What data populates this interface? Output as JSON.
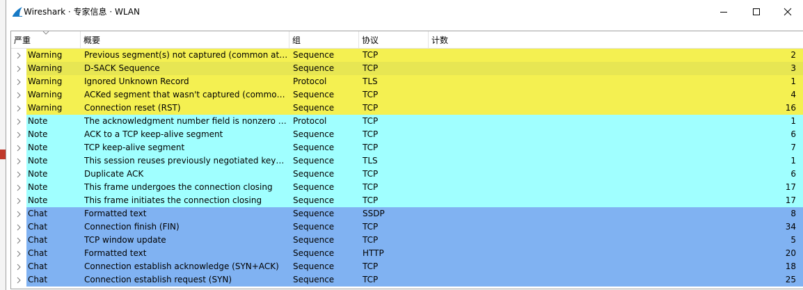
{
  "window": {
    "title": "Wireshark · 专家信息 · WLAN",
    "controls": {
      "minimize": "minimize",
      "maximize": "maximize",
      "close": "close"
    }
  },
  "colors": {
    "warning": "#f4f051",
    "warning_selected": "#e7e653",
    "note": "#a0ffff",
    "chat": "#80b2f2"
  },
  "table": {
    "columns": [
      "严重",
      "概要",
      "组",
      "协议",
      "计数"
    ],
    "rows": [
      {
        "severity": "Warning",
        "summary": "Previous segment(s) not captured (common at capture start)",
        "group": "Sequence",
        "protocol": "TCP",
        "count": "2",
        "type": "warning"
      },
      {
        "severity": "Warning",
        "summary": "D-SACK Sequence",
        "group": "Sequence",
        "protocol": "TCP",
        "count": "3",
        "type": "warning_selected"
      },
      {
        "severity": "Warning",
        "summary": "Ignored Unknown Record",
        "group": "Protocol",
        "protocol": "TLS",
        "count": "1",
        "type": "warning"
      },
      {
        "severity": "Warning",
        "summary": "ACKed segment that wasn't captured (common at capture start)",
        "group": "Sequence",
        "protocol": "TCP",
        "count": "4",
        "type": "warning"
      },
      {
        "severity": "Warning",
        "summary": "Connection reset (RST)",
        "group": "Sequence",
        "protocol": "TCP",
        "count": "16",
        "type": "warning"
      },
      {
        "severity": "Note",
        "summary": "The acknowledgment number field is nonzero while the ACK flag is not set",
        "group": "Protocol",
        "protocol": "TCP",
        "count": "1",
        "type": "note"
      },
      {
        "severity": "Note",
        "summary": "ACK to a TCP keep-alive segment",
        "group": "Sequence",
        "protocol": "TCP",
        "count": "6",
        "type": "note"
      },
      {
        "severity": "Note",
        "summary": "TCP keep-alive segment",
        "group": "Sequence",
        "protocol": "TCP",
        "count": "7",
        "type": "note"
      },
      {
        "severity": "Note",
        "summary": "This session reuses previously negotiated keys (Session resumption)",
        "group": "Sequence",
        "protocol": "TLS",
        "count": "1",
        "type": "note"
      },
      {
        "severity": "Note",
        "summary": "Duplicate ACK",
        "group": "Sequence",
        "protocol": "TCP",
        "count": "6",
        "type": "note"
      },
      {
        "severity": "Note",
        "summary": "This frame undergoes the connection closing",
        "group": "Sequence",
        "protocol": "TCP",
        "count": "17",
        "type": "note"
      },
      {
        "severity": "Note",
        "summary": "This frame initiates the connection closing",
        "group": "Sequence",
        "protocol": "TCP",
        "count": "17",
        "type": "note"
      },
      {
        "severity": "Chat",
        "summary": "Formatted text",
        "group": "Sequence",
        "protocol": "SSDP",
        "count": "8",
        "type": "chat"
      },
      {
        "severity": "Chat",
        "summary": "Connection finish (FIN)",
        "group": "Sequence",
        "protocol": "TCP",
        "count": "34",
        "type": "chat"
      },
      {
        "severity": "Chat",
        "summary": "TCP window update",
        "group": "Sequence",
        "protocol": "TCP",
        "count": "5",
        "type": "chat"
      },
      {
        "severity": "Chat",
        "summary": "Formatted text",
        "group": "Sequence",
        "protocol": "HTTP",
        "count": "20",
        "type": "chat"
      },
      {
        "severity": "Chat",
        "summary": "Connection establish acknowledge (SYN+ACK)",
        "group": "Sequence",
        "protocol": "TCP",
        "count": "18",
        "type": "chat"
      },
      {
        "severity": "Chat",
        "summary": "Connection establish request (SYN)",
        "group": "Sequence",
        "protocol": "TCP",
        "count": "25",
        "type": "chat"
      }
    ]
  }
}
